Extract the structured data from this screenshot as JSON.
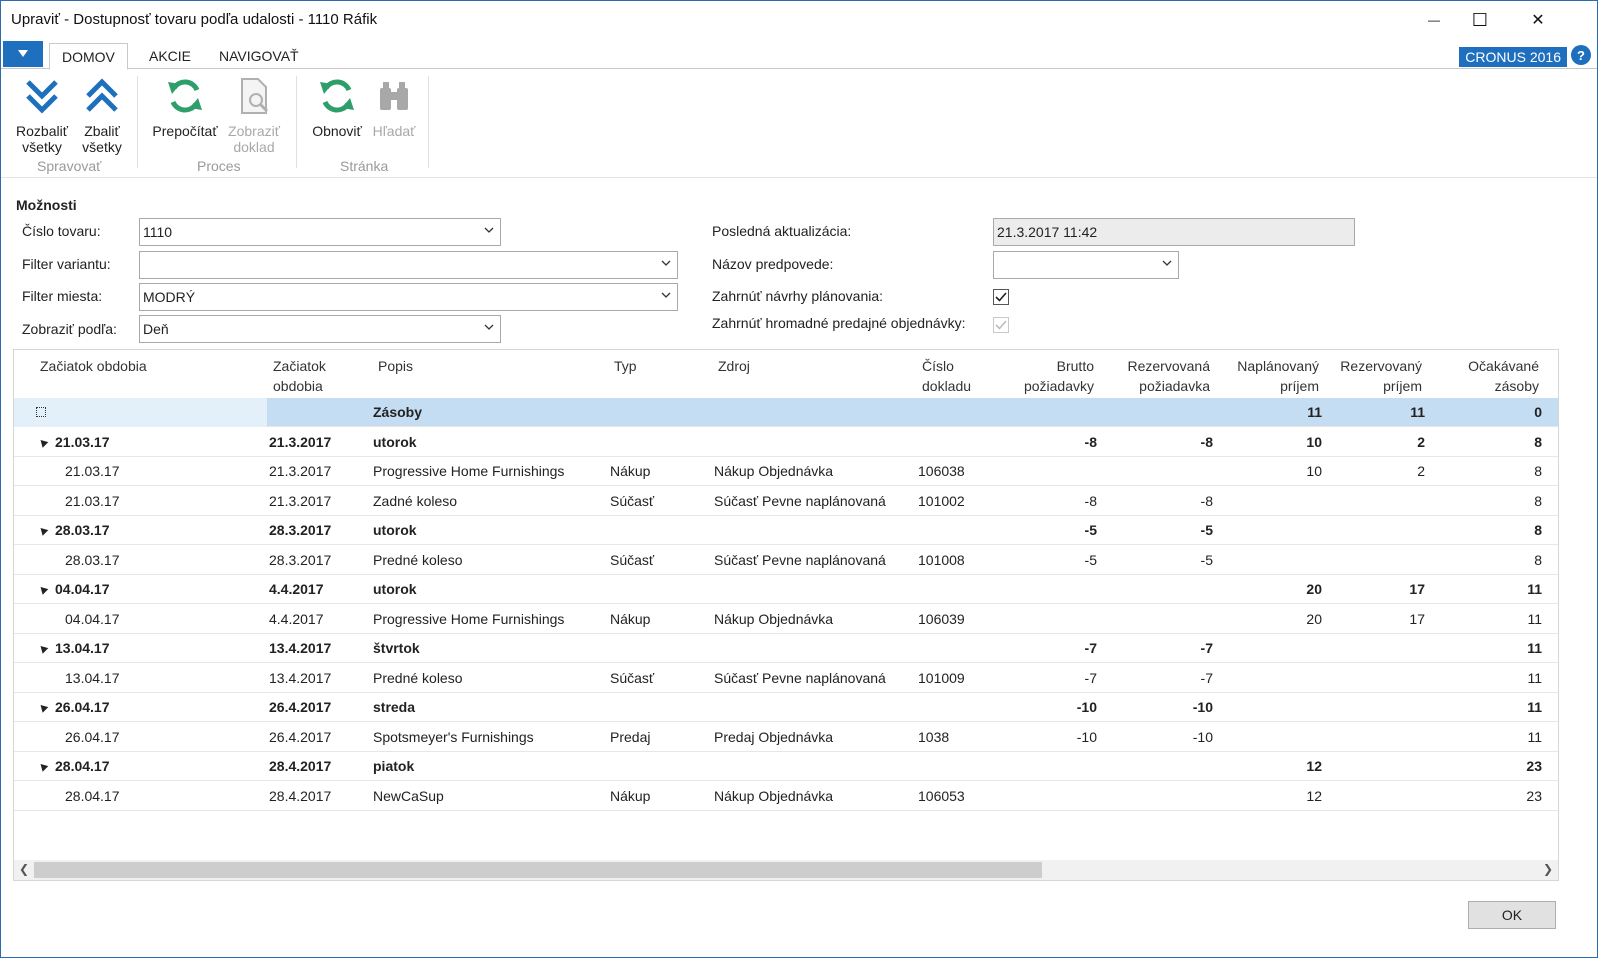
{
  "window": {
    "title": "Upraviť - Dostupnosť tovaru podľa udalosti - 1110 Ráfik",
    "minimize": "—",
    "maximize": "☐",
    "close": "✕"
  },
  "tabs": [
    "DOMOV",
    "AKCIE",
    "NAVIGOVAŤ"
  ],
  "company": "CRONUS 2016",
  "help_label": "?",
  "ribbon": {
    "expand_line1": "Rozbaliť",
    "expand_line2": "všetky",
    "collapse_line1": "Zbaliť",
    "collapse_line2": "všetky",
    "group_manage": "Spravovať",
    "recalc": "Prepočítať",
    "show_doc_line1": "Zobraziť",
    "show_doc_line2": "doklad",
    "group_process": "Proces",
    "refresh": "Obnoviť",
    "find": "Hľadať",
    "group_page": "Stránka"
  },
  "options": {
    "title": "Možnosti",
    "item_no_label": "Číslo tovaru:",
    "item_no": "1110",
    "variant_label": "Filter variantu:",
    "variant": "",
    "location_label": "Filter miesta:",
    "location": "MODRÝ",
    "view_by_label": "Zobraziť podľa:",
    "view_by": "Deň",
    "last_update_label": "Posledná aktualizácia:",
    "last_update": "21.3.2017 11:42",
    "forecast_label": "Názov predpovede:",
    "forecast": "",
    "include_planning_label": "Zahrnúť návrhy plánovania:",
    "include_planning": true,
    "include_blanket_label": "Zahrnúť hromadné predajné objednávky:",
    "include_blanket": true
  },
  "grid": {
    "headers": {
      "period_start": "Začiatok obdobia",
      "period_start2_l1": "Začiatok",
      "period_start2_l2": "obdobia",
      "description": "Popis",
      "type": "Typ",
      "source": "Zdroj",
      "doc_no_l1": "Číslo",
      "doc_no_l2": "dokladu",
      "gross_l1": "Brutto",
      "gross_l2": "požiadavky",
      "reserved_req_l1": "Rezervovaná",
      "reserved_req_l2": "požiadavka",
      "sched_rcpt_l1": "Naplánovaný",
      "sched_rcpt_l2": "príjem",
      "reserved_rcpt_l1": "Rezervovaný",
      "reserved_rcpt_l2": "príjem",
      "proj_inv_l1": "Očakávané",
      "proj_inv_l2": "zásoby"
    },
    "rows": [
      {
        "kind": "inventory",
        "c1": "",
        "c2": "",
        "desc": "Zásoby",
        "type": "",
        "source": "",
        "doc": "",
        "gross": "",
        "resreq": "",
        "sched": "11",
        "resrcpt": "11",
        "proj": "0"
      },
      {
        "kind": "group",
        "c1": "21.03.17",
        "c2": "21.3.2017",
        "desc": "utorok",
        "type": "",
        "source": "",
        "doc": "",
        "gross": "-8",
        "resreq": "-8",
        "sched": "10",
        "resrcpt": "2",
        "proj": "8"
      },
      {
        "kind": "line",
        "c1": "21.03.17",
        "c2": "21.3.2017",
        "desc": "Progressive Home Furnishings",
        "type": "Nákup",
        "source": "Nákup Objednávka",
        "doc": "106038",
        "gross": "",
        "resreq": "",
        "sched": "10",
        "resrcpt": "2",
        "proj": "8"
      },
      {
        "kind": "line",
        "c1": "21.03.17",
        "c2": "21.3.2017",
        "desc": "Zadné koleso",
        "type": "Súčasť",
        "source": "Súčasť Pevne naplánovaná",
        "doc": "101002",
        "gross": "-8",
        "resreq": "-8",
        "sched": "",
        "resrcpt": "",
        "proj": "8"
      },
      {
        "kind": "group",
        "c1": "28.03.17",
        "c2": "28.3.2017",
        "desc": "utorok",
        "type": "",
        "source": "",
        "doc": "",
        "gross": "-5",
        "resreq": "-5",
        "sched": "",
        "resrcpt": "",
        "proj": "8"
      },
      {
        "kind": "line",
        "c1": "28.03.17",
        "c2": "28.3.2017",
        "desc": "Predné koleso",
        "type": "Súčasť",
        "source": "Súčasť Pevne naplánovaná",
        "doc": "101008",
        "gross": "-5",
        "resreq": "-5",
        "sched": "",
        "resrcpt": "",
        "proj": "8"
      },
      {
        "kind": "group",
        "c1": "04.04.17",
        "c2": "4.4.2017",
        "desc": "utorok",
        "type": "",
        "source": "",
        "doc": "",
        "gross": "",
        "resreq": "",
        "sched": "20",
        "resrcpt": "17",
        "proj": "11"
      },
      {
        "kind": "line",
        "c1": "04.04.17",
        "c2": "4.4.2017",
        "desc": "Progressive Home Furnishings",
        "type": "Nákup",
        "source": "Nákup Objednávka",
        "doc": "106039",
        "gross": "",
        "resreq": "",
        "sched": "20",
        "resrcpt": "17",
        "proj": "11"
      },
      {
        "kind": "group",
        "c1": "13.04.17",
        "c2": "13.4.2017",
        "desc": "štvrtok",
        "type": "",
        "source": "",
        "doc": "",
        "gross": "-7",
        "resreq": "-7",
        "sched": "",
        "resrcpt": "",
        "proj": "11"
      },
      {
        "kind": "line",
        "c1": "13.04.17",
        "c2": "13.4.2017",
        "desc": "Predné koleso",
        "type": "Súčasť",
        "source": "Súčasť Pevne naplánovaná",
        "doc": "101009",
        "gross": "-7",
        "resreq": "-7",
        "sched": "",
        "resrcpt": "",
        "proj": "11"
      },
      {
        "kind": "group",
        "c1": "26.04.17",
        "c2": "26.4.2017",
        "desc": "streda",
        "type": "",
        "source": "",
        "doc": "",
        "gross": "-10",
        "resreq": "-10",
        "sched": "",
        "resrcpt": "",
        "proj": "11"
      },
      {
        "kind": "line",
        "c1": "26.04.17",
        "c2": "26.4.2017",
        "desc": "Spotsmeyer's Furnishings",
        "type": "Predaj",
        "source": "Predaj Objednávka",
        "doc": "1038",
        "gross": "-10",
        "resreq": "-10",
        "sched": "",
        "resrcpt": "",
        "proj": "11"
      },
      {
        "kind": "group",
        "c1": "28.04.17",
        "c2": "28.4.2017",
        "desc": "piatok",
        "type": "",
        "source": "",
        "doc": "",
        "gross": "",
        "resreq": "",
        "sched": "12",
        "resrcpt": "",
        "proj": "23"
      },
      {
        "kind": "line",
        "c1": "28.04.17",
        "c2": "28.4.2017",
        "desc": "NewCaSup",
        "type": "Nákup",
        "source": "Nákup Objednávka",
        "doc": "106053",
        "gross": "",
        "resreq": "",
        "sched": "12",
        "resrcpt": "",
        "proj": "23"
      }
    ]
  },
  "ok_label": "OK"
}
